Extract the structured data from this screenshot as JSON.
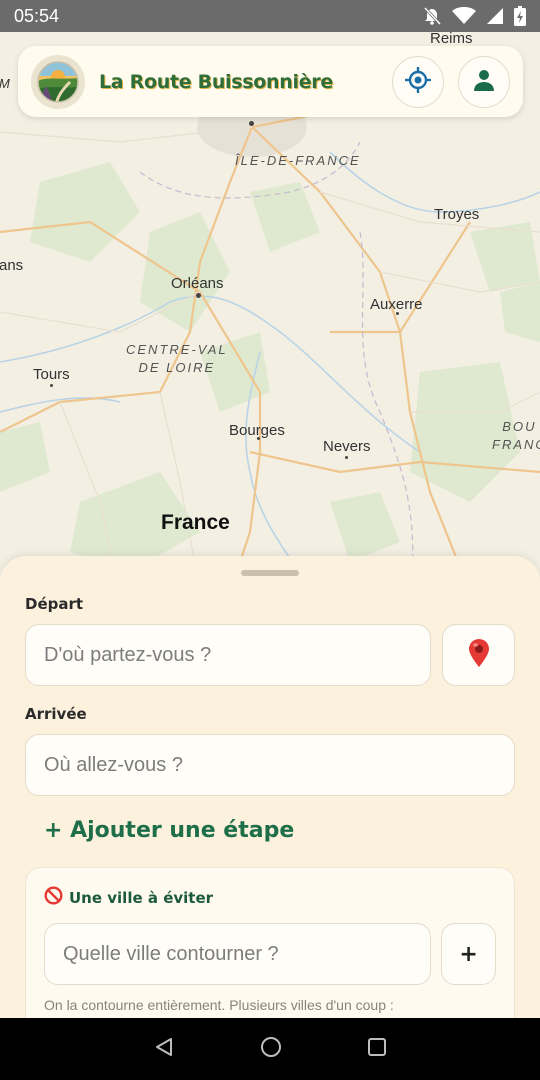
{
  "status_bar": {
    "time": "05:54",
    "icons": [
      "notifications-off-icon",
      "wifi-icon",
      "signal-icon",
      "battery-charging-icon"
    ]
  },
  "map": {
    "cities": [
      "Reims",
      "Troyes",
      "Orléans",
      "Auxerre",
      "Tours",
      "Bourges",
      "Nevers"
    ],
    "partial_labels": {
      "left_top": "M",
      "left_mid": "ans",
      "right_region_1": "BOU",
      "right_region_2": "FRANC"
    },
    "regions": {
      "ile_de_france": "ÎLE-DE-FRANCE",
      "centre_line1": "CENTRE-VAL",
      "centre_line2": "DE LOIRE"
    },
    "country": "France"
  },
  "header": {
    "title": "La Route Buissonnière",
    "icons": [
      "logo-icon",
      "locate-icon",
      "user-icon"
    ]
  },
  "form": {
    "departure": {
      "label": "Départ",
      "placeholder": "D'où partez-vous ?"
    },
    "arrival": {
      "label": "Arrivée",
      "placeholder": "Où allez-vous ?"
    },
    "add_step_label": "+ Ajouter une étape",
    "avoid": {
      "title": "Une ville à éviter",
      "placeholder": "Quelle ville contourner ?",
      "add_label": "+",
      "hint": "On la contourne entièrement. Plusieurs villes d'un coup :"
    }
  },
  "colors": {
    "accent_green": "#1d6e49",
    "title_green": "#2f6e3a",
    "sheet_bg": "#fcf1dc",
    "locate_blue": "#1b6fa8",
    "user_green": "#1a6b4b"
  }
}
